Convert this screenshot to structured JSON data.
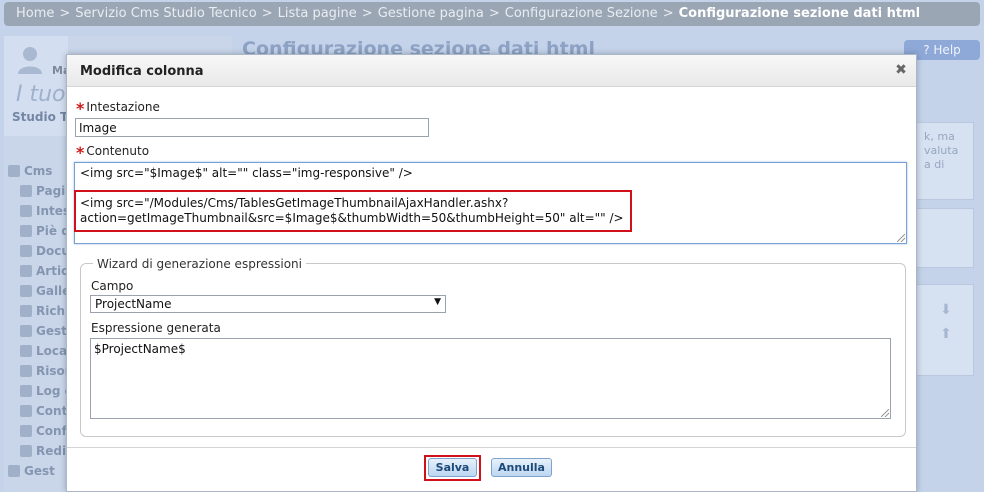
{
  "breadcrumb": {
    "items": [
      "Home",
      "Servizio Cms Studio Tecnico",
      "Lista pagine",
      "Gestione pagina",
      "Configurazione Sezione"
    ],
    "current": "Configurazione sezione dati html",
    "separator": ">"
  },
  "background": {
    "page_title": "Configurazione sezione dati html",
    "help_label": "Help",
    "user_initial": "Ma",
    "user_welcome": "I tuo",
    "user_studio": "Studio T",
    "menu": [
      {
        "label": "Cms",
        "icon": "cms-icon"
      },
      {
        "label": "Pagi",
        "icon": "page-icon"
      },
      {
        "label": "Intes",
        "icon": "header-icon"
      },
      {
        "label": "Piè d",
        "icon": "footer-icon"
      },
      {
        "label": "Docu",
        "icon": "document-icon"
      },
      {
        "label": "Artic",
        "icon": "article-icon"
      },
      {
        "label": "Galle",
        "icon": "gallery-icon"
      },
      {
        "label": "Richi",
        "icon": "request-icon"
      },
      {
        "label": "Gesti",
        "icon": "manage-icon"
      },
      {
        "label": "Loca",
        "icon": "location-icon"
      },
      {
        "label": "Risor",
        "icon": "resource-icon"
      },
      {
        "label": "Log c",
        "icon": "log-icon"
      },
      {
        "label": "Cont",
        "icon": "contact-icon"
      },
      {
        "label": "Conf",
        "icon": "config-icon"
      },
      {
        "label": "Redi",
        "icon": "redirect-icon"
      },
      {
        "label": "Gest",
        "icon": "manage-icon"
      }
    ],
    "right_text": [
      "k, ma",
      "valuta",
      "a di"
    ]
  },
  "modal": {
    "title": "Modifica colonna",
    "close_icon": "close-icon",
    "heading_label": "Intestazione",
    "heading_value": "Image",
    "content_label": "Contenuto",
    "content_line1": "<img src=\"$Image$\" alt=\"\" class=\"img-responsive\" />",
    "content_line2": "<img src=\"/Modules/Cms/TablesGetImageThumbnailAjaxHandler.ashx?",
    "content_line3": "action=getImageThumbnail&src=$Image$&thumbWidth=50&thumbHeight=50\" alt=\"\" />",
    "wizard_legend": "Wizard di generazione espressioni",
    "field_label": "Campo",
    "field_value": "ProjectName",
    "expression_label": "Espressione generata",
    "expression_value": "$ProjectName$",
    "save_label": "Salva",
    "cancel_label": "Annulla"
  },
  "colors": {
    "accent_red": "#d0111a",
    "button_blue": "#bcd6f1",
    "overlay": "#c4d3ea"
  }
}
